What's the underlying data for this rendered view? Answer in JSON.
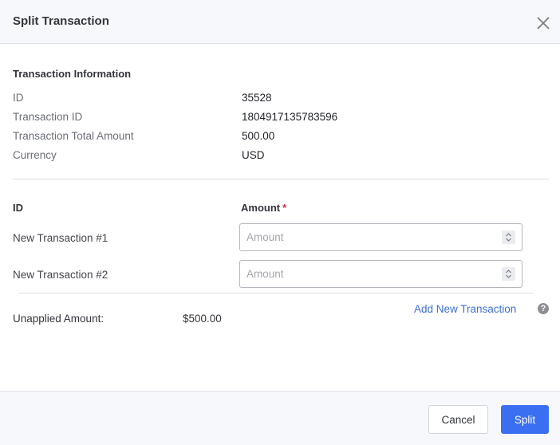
{
  "dialog": {
    "title": "Split Transaction",
    "close_icon": "close-icon"
  },
  "transaction_info": {
    "section_title": "Transaction Information",
    "fields": [
      {
        "label": "ID",
        "value": "35528"
      },
      {
        "label": "Transaction ID",
        "value": "1804917135783596"
      },
      {
        "label": "Transaction Total Amount",
        "value": "500.00"
      },
      {
        "label": "Currency",
        "value": "USD"
      }
    ]
  },
  "split_table": {
    "id_header": "ID",
    "amount_header": "Amount",
    "required_marker": "*",
    "rows": [
      {
        "label": "New Transaction #1",
        "value": "",
        "placeholder": "Amount"
      },
      {
        "label": "New Transaction #2",
        "value": "",
        "placeholder": "Amount"
      }
    ]
  },
  "summary": {
    "unapplied_label": "Unapplied Amount:",
    "unapplied_value": "$500.00",
    "add_link": "Add New Transaction",
    "help_icon": "?"
  },
  "footer": {
    "cancel_label": "Cancel",
    "split_label": "Split"
  },
  "colors": {
    "primary": "#3a6ff2",
    "link": "#3b6fd9",
    "required": "#d0304a"
  }
}
